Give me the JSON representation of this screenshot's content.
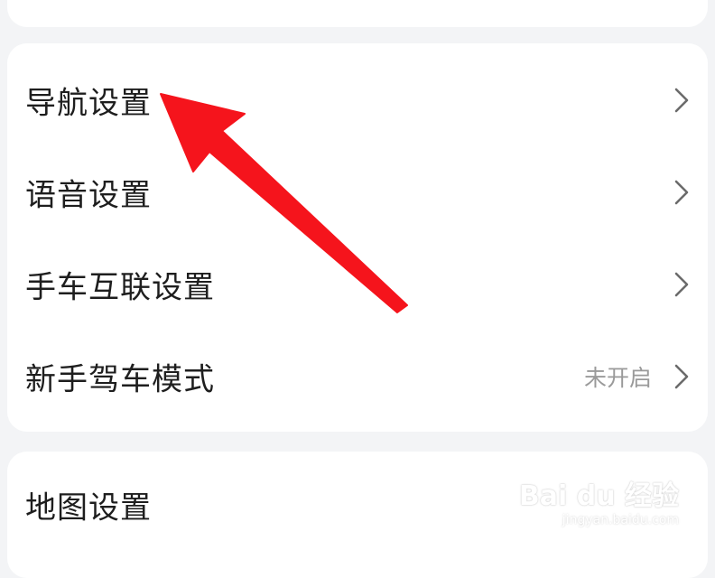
{
  "settings": {
    "items": [
      {
        "label": "导航设置",
        "status": "",
        "icon": "chevron-right-icon"
      },
      {
        "label": "语音设置",
        "status": "",
        "icon": "chevron-right-icon"
      },
      {
        "label": "手车互联设置",
        "status": "",
        "icon": "chevron-right-icon"
      },
      {
        "label": "新手驾车模式",
        "status": "未开启",
        "icon": "chevron-right-icon"
      }
    ],
    "bottom_item": {
      "label": "地图设置"
    }
  },
  "annotation": {
    "icon": "red-arrow-icon",
    "color": "#f5141c"
  },
  "watermark": {
    "logo": "Bai du 经验",
    "url": "jingyan.baidu.com"
  },
  "colors": {
    "background": "#f3f4f6",
    "card": "#ffffff",
    "text": "#1e1e1e",
    "secondary": "#9a9a9a",
    "chevron": "#6b6b6b"
  }
}
